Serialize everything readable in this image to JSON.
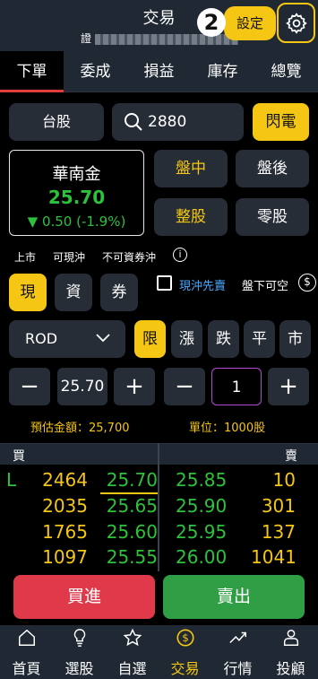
{
  "header": {
    "title": "交易",
    "account_prefix": "證",
    "step_badge": "2",
    "settings_label": "設定",
    "gear_icon": "gear-icon"
  },
  "tabs": [
    {
      "label": "下單",
      "active": true
    },
    {
      "label": "委成"
    },
    {
      "label": "損益"
    },
    {
      "label": "庫存"
    },
    {
      "label": "總覽"
    }
  ],
  "order": {
    "market_label": "台股",
    "search_value": "2880",
    "flash_label": "閃電",
    "session_buttons": [
      "盤中",
      "盤後",
      "整股",
      "零股"
    ],
    "stock": {
      "name": "華南金",
      "price": "25.70",
      "change": "▼ 0.50 (-1.9%)"
    },
    "status_tags": [
      "上市",
      "可現沖",
      "不可資券沖"
    ],
    "info_icon_glyph": "i",
    "trade_types": [
      "現",
      "資",
      "券"
    ],
    "daytrade_first_label": "現沖先賣",
    "after_close_label": "盤下可空",
    "dollar_icon_glyph": "$",
    "time_in_force": "ROD",
    "price_types": [
      "限",
      "漲",
      "跌",
      "平",
      "市"
    ],
    "price_value": "25.70",
    "quantity_value": "1",
    "estimated_amount": "預估金額：25,700",
    "unit": "單位：1000股",
    "minus": "−",
    "plus": "+"
  },
  "order_book": {
    "buy_header": "買",
    "sell_header": "賣",
    "rows": [
      {
        "marker": "L",
        "bid_qty": "2464",
        "bid_price": "25.70",
        "ask_price": "25.85",
        "ask_qty": "10"
      },
      {
        "marker": "",
        "bid_qty": "2035",
        "bid_price": "25.65",
        "ask_price": "25.90",
        "ask_qty": "301"
      },
      {
        "marker": "",
        "bid_qty": "1765",
        "bid_price": "25.60",
        "ask_price": "25.95",
        "ask_qty": "137"
      },
      {
        "marker": "",
        "bid_qty": "1097",
        "bid_price": "25.55",
        "ask_price": "26.00",
        "ask_qty": "1041"
      }
    ]
  },
  "actions": {
    "buy_label": "買進",
    "sell_label": "賣出"
  },
  "bottom_nav": [
    {
      "label": "首頁",
      "icon": "home-icon"
    },
    {
      "label": "選股",
      "icon": "lightbulb-icon"
    },
    {
      "label": "自選",
      "icon": "star-icon"
    },
    {
      "label": "交易",
      "icon": "dollar-coin-icon",
      "active": true
    },
    {
      "label": "行情",
      "icon": "trend-icon"
    },
    {
      "label": "投顧",
      "icon": "advisor-icon"
    }
  ],
  "colors": {
    "accent": "#f5c613",
    "up": "#e23d3d",
    "down": "#2dc23c",
    "buy": "#e03a4a",
    "sell": "#2f9e44",
    "panel": "#262d36"
  }
}
